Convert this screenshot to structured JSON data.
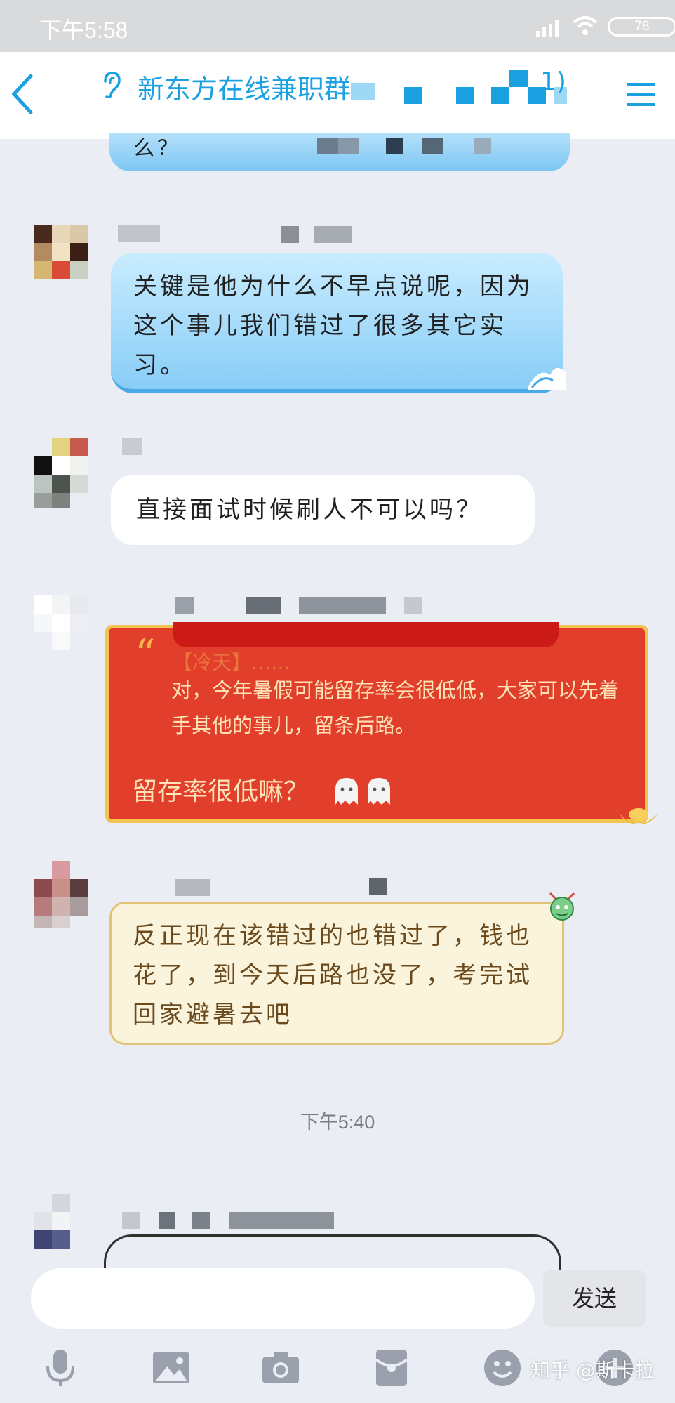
{
  "status_bar": {
    "time": "下午5:58",
    "battery": "78"
  },
  "header": {
    "title": "新东方在线兼职群",
    "title_tail": "1)"
  },
  "messages": [
    {
      "kind": "partial-blue",
      "text": "么？"
    },
    {
      "kind": "blue",
      "text": "关键是他为什么不早点说呢，因为这个事儿我们错过了很多其它实习。"
    },
    {
      "kind": "white",
      "text": "直接面试时候刷人不可以吗？"
    },
    {
      "kind": "red-reply",
      "quote_ref": "【冷天】……",
      "quote_text": "对，今年暑假可能留存率会很低低，大家可以先着手其他的事儿，留条后路。",
      "reply": "留存率很低嘛？"
    },
    {
      "kind": "yellow",
      "text": "反正现在该错过的也错过了，钱也花了，到今天后路也没了，考完试回家避暑去吧"
    }
  ],
  "time_divider": "下午5:40",
  "input": {
    "placeholder": "",
    "send_label": "发送"
  },
  "toolbar": [
    "mic-icon",
    "image-icon",
    "camera-icon",
    "red-packet-icon",
    "emoji-icon",
    "plus-icon"
  ],
  "watermark": "知乎 @斯卡拉",
  "colors": {
    "accent": "#1ba1e2",
    "red_card": "#e13f2b",
    "gold": "#f2c34e",
    "background": "#eaedf4"
  }
}
